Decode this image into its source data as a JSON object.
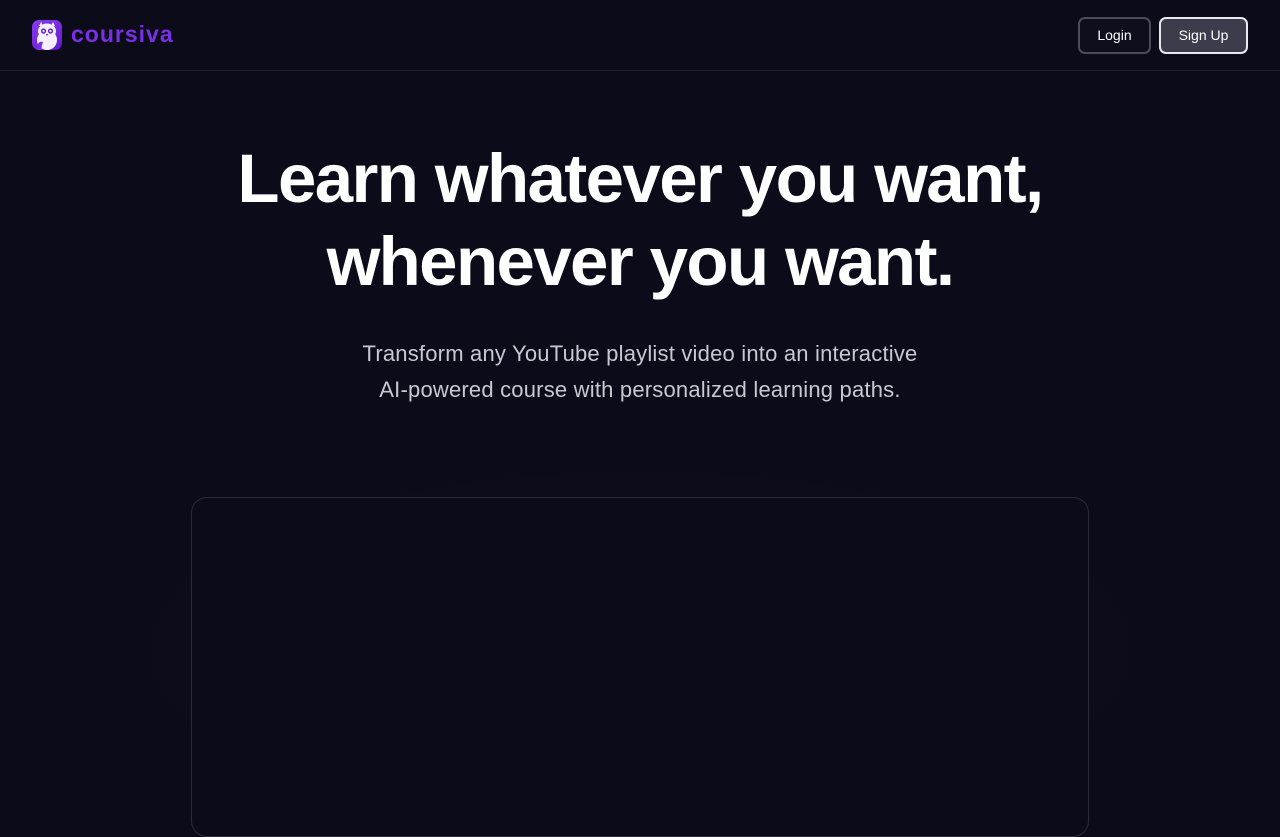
{
  "header": {
    "brand_name": "coursiva",
    "logo_icon": "owl-logo-icon",
    "login_label": "Login",
    "signup_label": "Sign Up"
  },
  "hero": {
    "title": "Learn whatever you want, whenever you want.",
    "subtitle": "Transform any YouTube playlist video into an interactive AI-powered course with personalized learning paths."
  },
  "colors": {
    "background": "#0b0b19",
    "brand": "#7a2fe4",
    "subtitle": "#c8c8d0",
    "border": "#22222e"
  }
}
